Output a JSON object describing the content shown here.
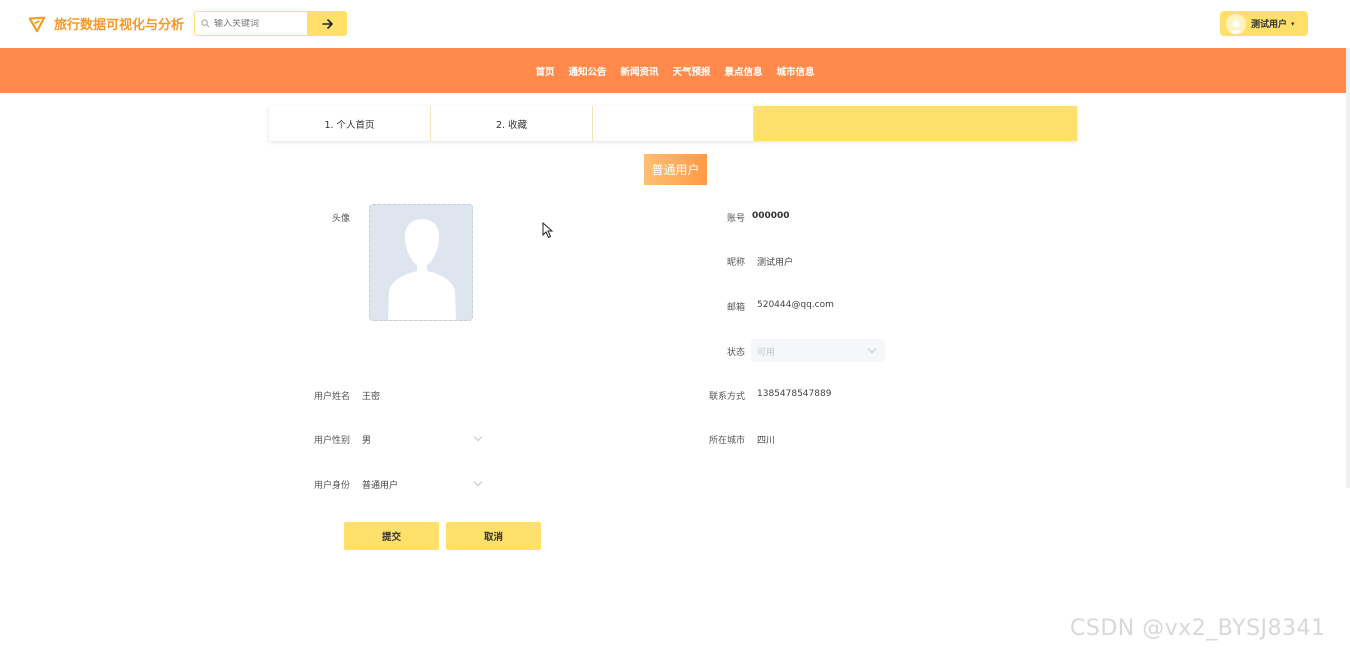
{
  "header": {
    "logo_text": "旅行数据可视化与分析",
    "search_placeholder": "输入关键词",
    "user_name": "测试用户",
    "user_caret": "▾"
  },
  "nav": {
    "items": [
      "首页",
      "通知公告",
      "新闻资讯",
      "天气预报",
      "景点信息",
      "城市信息"
    ]
  },
  "tabs": [
    "1. 个人首页",
    "2. 收藏"
  ],
  "role_badge": "普通用户",
  "form": {
    "avatar_label": "头像",
    "account_label": "账号",
    "account_value": "000000",
    "nickname_label": "昵称",
    "nickname_value": "测试用户",
    "email_label": "邮箱",
    "email_value": "520444@qq.com",
    "status_label": "状态",
    "status_value": "可用",
    "realname_label": "用户姓名",
    "realname_value": "王密",
    "phone_label": "联系方式",
    "phone_value": "1385478547889",
    "gender_label": "用户性别",
    "gender_value": "男",
    "city_label": "所在城市",
    "city_value": "四川",
    "identity_label": "用户身份",
    "identity_value": "普通用户"
  },
  "buttons": {
    "submit": "提交",
    "cancel": "取消"
  },
  "watermark": "CSDN @vx2_BYSJ8341",
  "colors": {
    "accent_yellow": "#ffe06b",
    "nav_orange": "#ff8a4c",
    "logo_orange": "#f39a2b"
  }
}
